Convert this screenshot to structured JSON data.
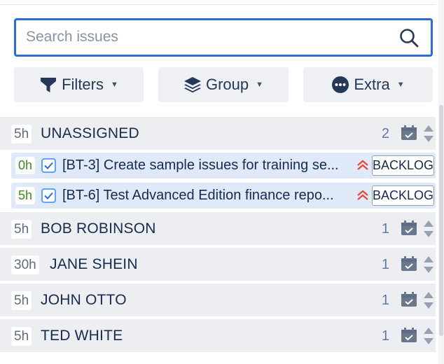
{
  "search": {
    "placeholder": "Search issues",
    "value": ""
  },
  "toolbar": {
    "filters_label": "Filters",
    "group_label": "Group",
    "extra_label": "Extra"
  },
  "groups": [
    {
      "hours": "5h",
      "name": "UNASSIGNED",
      "count": "2",
      "issues": [
        {
          "hours": "0h",
          "text": "[BT-3] Create sample issues for training se...",
          "status": "BACKLOG",
          "priority": "highest"
        },
        {
          "hours": "5h",
          "text": "[BT-6] Test Advanced Edition finance repo...",
          "status": "BACKLOG",
          "priority": "highest"
        }
      ]
    },
    {
      "hours": "5h",
      "name": "BOB ROBINSON",
      "count": "1"
    },
    {
      "hours": "30h",
      "name": "JANE SHEIN",
      "count": "1"
    },
    {
      "hours": "5h",
      "name": "JOHN OTTO",
      "count": "1"
    },
    {
      "hours": "5h",
      "name": "TED WHITE",
      "count": "1"
    }
  ],
  "colors": {
    "accent": "#2c6cd9",
    "hours_green": "#3e8e1e",
    "priority_red": "#e5493a",
    "group_bg": "#eceef1",
    "issue_bg": "#dfe9f8"
  },
  "icons": [
    "search-icon",
    "filter-icon",
    "layers-icon",
    "more-icon",
    "calendar-icon",
    "sort-icon",
    "checkbox-icon",
    "priority-highest-icon"
  ]
}
